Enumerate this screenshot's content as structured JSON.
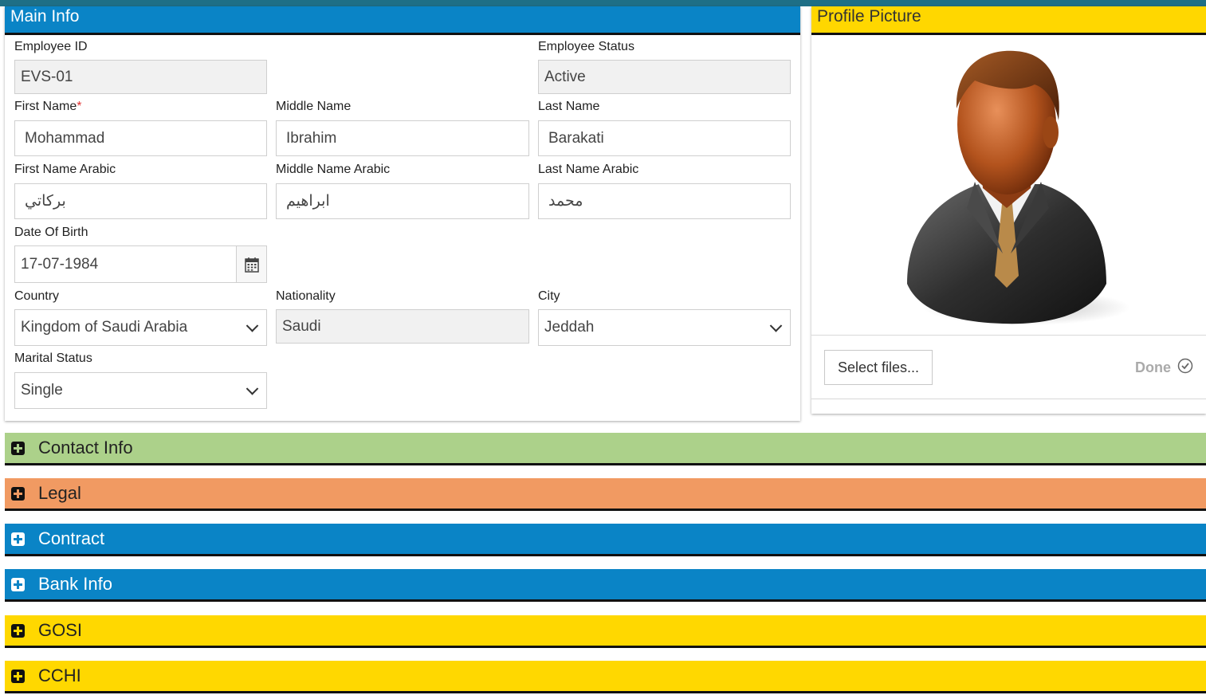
{
  "main_info": {
    "title": "Main Info",
    "employee_id": {
      "label": "Employee ID",
      "value": "EVS-01"
    },
    "employee_status": {
      "label": "Employee Status",
      "value": "Active"
    },
    "first_name": {
      "label": "First Name",
      "required_mark": "*",
      "value": "Mohammad"
    },
    "middle_name": {
      "label": "Middle Name",
      "value": "Ibrahim"
    },
    "last_name": {
      "label": "Last Name",
      "value": "Barakati"
    },
    "first_name_arabic": {
      "label": "First Name Arabic",
      "value": "بركاتي"
    },
    "middle_name_arabic": {
      "label": "Middle Name Arabic",
      "value": "ابراهيم"
    },
    "last_name_arabic": {
      "label": "Last Name Arabic",
      "value": "محمد"
    },
    "date_of_birth": {
      "label": "Date Of Birth",
      "value": "17-07-1984",
      "icon": "calendar-icon"
    },
    "country": {
      "label": "Country",
      "value": "Kingdom of Saudi Arabia",
      "icon": "chevron-down-icon"
    },
    "nationality": {
      "label": "Nationality",
      "value": "Saudi"
    },
    "city": {
      "label": "City",
      "value": "Jeddah",
      "icon": "chevron-down-icon"
    },
    "marital_status": {
      "label": "Marital Status",
      "value": "Single",
      "icon": "chevron-down-icon"
    }
  },
  "profile_picture": {
    "title": "Profile Picture",
    "avatar_icon": "businessman-avatar-icon",
    "select_button": "Select files...",
    "done_label": "Done",
    "done_icon": "check-circle-icon"
  },
  "sections": [
    {
      "label": "Contact Info",
      "color": "#acd18a",
      "icon": "expand-plus-icon"
    },
    {
      "label": "Legal",
      "color": "#f19a62",
      "icon": "expand-plus-icon"
    },
    {
      "label": "Contract",
      "color": "#0a84c6",
      "icon": "expand-plus-icon"
    },
    {
      "label": "Bank Info",
      "color": "#0a84c6",
      "icon": "expand-plus-icon"
    },
    {
      "label": "GOSI",
      "color": "#ffd800",
      "icon": "expand-plus-icon"
    },
    {
      "label": "CCHI",
      "color": "#ffd800",
      "icon": "expand-plus-icon"
    }
  ],
  "colors": {
    "blue_header": "#0a84c6",
    "yellow_header": "#ffd700",
    "window_edge": "#1e6f86"
  }
}
